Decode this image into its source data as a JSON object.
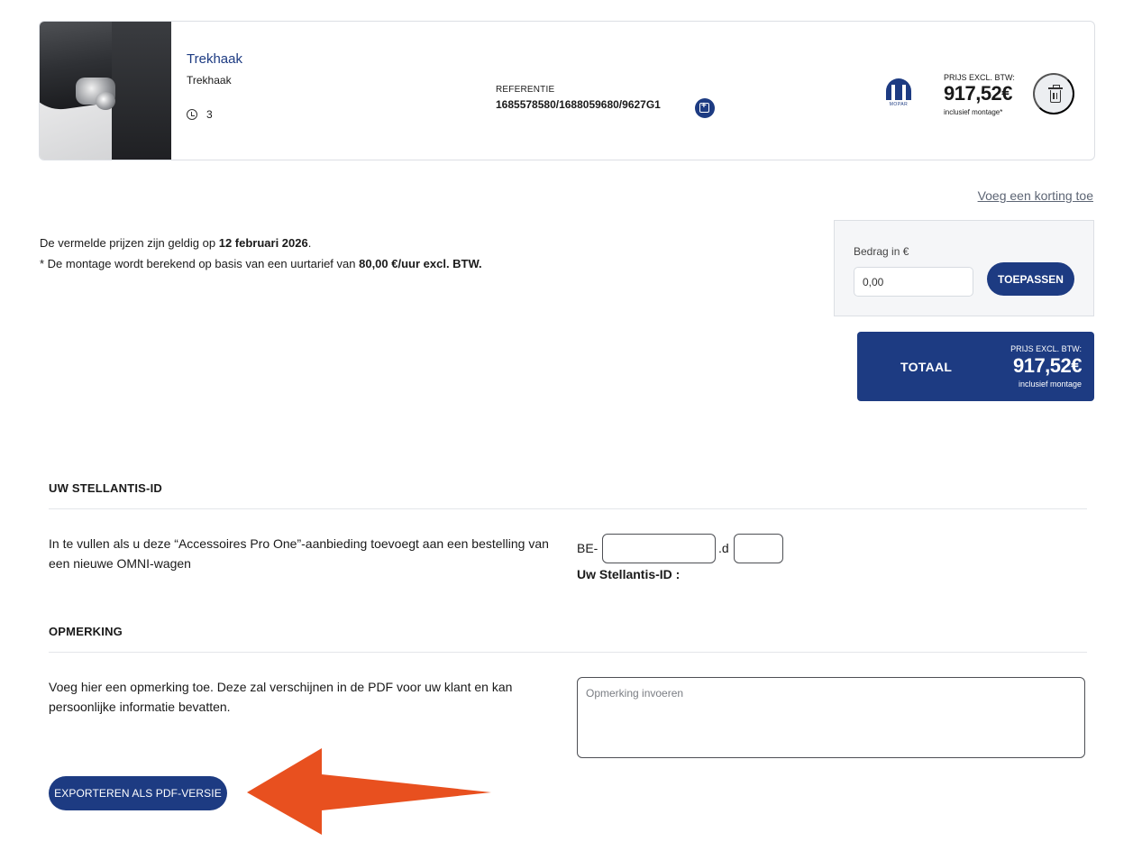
{
  "product": {
    "title": "Trekhaak",
    "subtitle": "Trekhaak",
    "quantity": "3",
    "reference_label": "REFERENTIE",
    "reference_value": "1685578580/1688059680/9627G1",
    "brand_logo_text": "MOPAR",
    "price_label": "PRIJS EXCL. BTW:",
    "price_value": "917,52€",
    "price_note": "inclusief montage*"
  },
  "discount": {
    "link_label": "Voeg een korting toe",
    "amount_label": "Bedrag in €",
    "amount_value": "0,00",
    "apply_label": "TOEPASSEN"
  },
  "validity": {
    "line1_prefix": "De vermelde prijzen zijn geldig op ",
    "line1_date": "12 februari 2026",
    "line1_suffix": ".",
    "line2_prefix": "* De montage wordt berekend op basis van een uurtarief van ",
    "line2_rate": "80,00 €/uur excl. BTW."
  },
  "total": {
    "label": "TOTAAL",
    "price_label": "PRIJS EXCL. BTW:",
    "price_value": "917,52€",
    "note": "inclusief montage"
  },
  "stellantis": {
    "section_title": "UW STELLANTIS-ID",
    "description": "In te vullen als u deze “Accessoires Pro One”-aanbieding toevoegt aan een bestelling van een nieuwe OMNI-wagen",
    "prefix": "BE-",
    "separator": ".d",
    "id_label": "Uw Stellantis-ID :",
    "id_value": "",
    "d_value": ""
  },
  "remark": {
    "section_title": "OPMERKING",
    "description": "Voeg hier een opmerking toe. Deze zal verschijnen in de PDF voor uw klant en kan persoonlijke informatie bevatten.",
    "placeholder": "Opmerking invoeren",
    "value": ""
  },
  "export": {
    "button_label": "EXPORTEREN ALS PDF-VERSIE"
  },
  "colors": {
    "brand_navy": "#1d3b82",
    "annotation_arrow": "#e8501f"
  },
  "icons": {
    "clock": "clock-icon",
    "reference_add": "add-to-quote-icon",
    "delete": "trash-icon",
    "annotation": "arrow-left-icon"
  }
}
